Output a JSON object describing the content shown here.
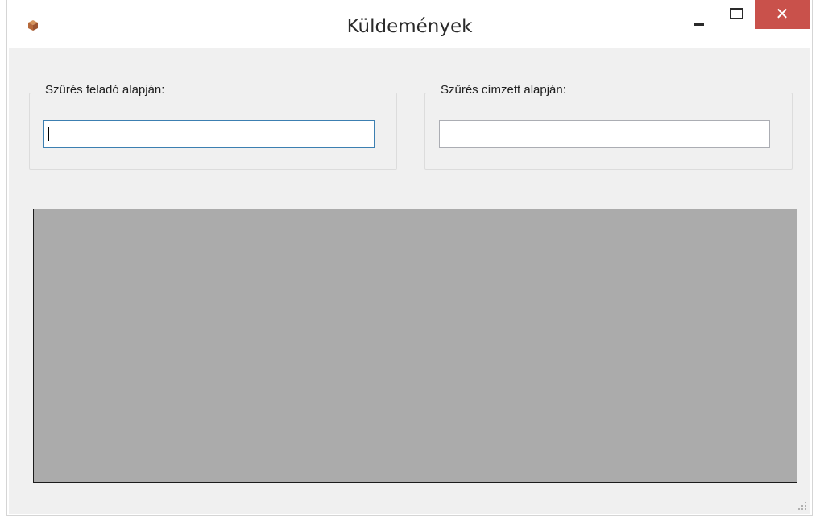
{
  "window": {
    "title": "Küldemények",
    "app_icon": "package-icon",
    "controls": {
      "minimize": "minimize-icon",
      "maximize": "maximize-icon",
      "close": "close-icon"
    },
    "close_color": "#c9514b"
  },
  "filters": {
    "sender": {
      "label": "Szűrés feladó alapján:",
      "value": "",
      "placeholder": "",
      "focused": true
    },
    "recipient": {
      "label": "Szűrés címzett alapján:",
      "value": "",
      "placeholder": "",
      "focused": false
    }
  },
  "data_grid": {
    "rows": [],
    "background_color": "#ababab"
  }
}
